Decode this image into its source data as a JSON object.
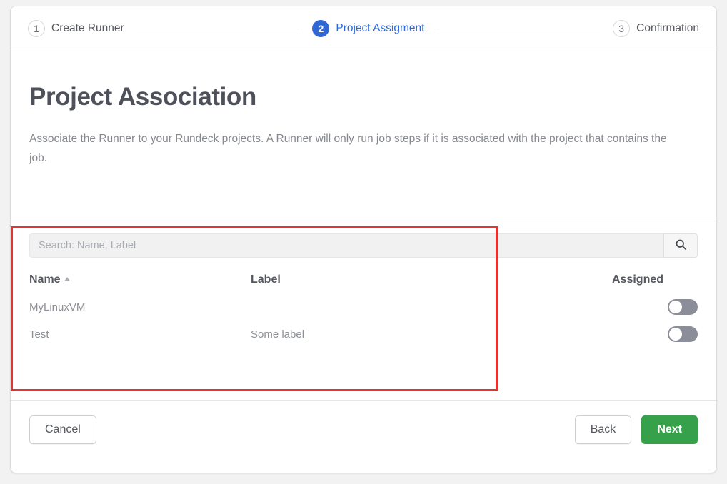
{
  "stepper": {
    "steps": [
      {
        "number": "1",
        "label": "Create Runner",
        "state": "inactive"
      },
      {
        "number": "2",
        "label": "Project Assigment",
        "state": "active"
      },
      {
        "number": "3",
        "label": "Confirmation",
        "state": "inactive"
      }
    ],
    "active_color": "#3067d4"
  },
  "main": {
    "title": "Project Association",
    "description": "Associate the Runner to your Rundeck projects. A Runner will only run job steps if it is associated with the project that contains the job."
  },
  "search": {
    "placeholder": "Search: Name, Label",
    "value": "",
    "button_icon": "search-icon"
  },
  "table": {
    "columns": [
      {
        "key": "name",
        "label": "Name",
        "sort": "asc"
      },
      {
        "key": "label",
        "label": "Label"
      },
      {
        "key": "assigned",
        "label": "Assigned"
      }
    ],
    "rows": [
      {
        "name": "MyLinuxVM",
        "label": "",
        "assigned": false
      },
      {
        "name": "Test",
        "label": "Some label",
        "assigned": false
      }
    ]
  },
  "footer": {
    "cancel_label": "Cancel",
    "back_label": "Back",
    "next_label": "Next",
    "next_color": "#37a04a"
  },
  "annotation": {
    "color": "#e3342f"
  }
}
